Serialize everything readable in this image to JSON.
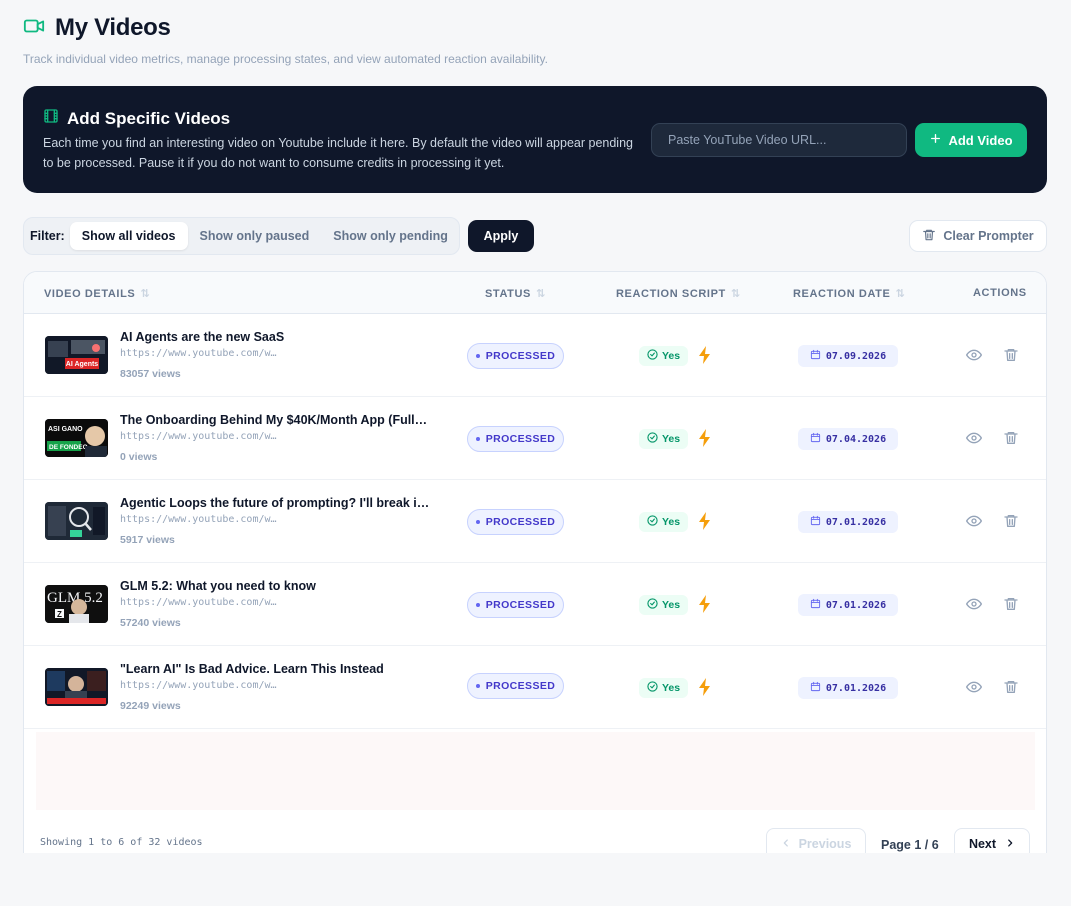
{
  "header": {
    "title": "My Videos",
    "subtitle": "Track individual video metrics, manage processing states, and view automated reaction availability."
  },
  "add_panel": {
    "title": "Add Specific Videos",
    "description": "Each time you find an interesting video on Youtube include it here. By default the video will appear pending to be processed. Pause it if you do not want to consume credits in processing it yet.",
    "url_placeholder": "Paste YouTube Video URL...",
    "add_label": "Add Video"
  },
  "filter": {
    "label": "Filter:",
    "tabs": [
      "Show all videos",
      "Show only paused",
      "Show only pending"
    ],
    "active": "Show all videos",
    "apply_label": "Apply",
    "clear_label": "Clear Prompter"
  },
  "table": {
    "columns": [
      "VIDEO DETAILS",
      "STATUS",
      "REACTION SCRIPT",
      "REACTION DATE",
      "ACTIONS"
    ],
    "rows": [
      {
        "title": "AI Agents are the new SaaS",
        "url": "https://www.youtube.com/w…",
        "views": "83057 views",
        "status": "PROCESSED",
        "script": "Yes",
        "date": "07.09.2026"
      },
      {
        "title": "The Onboarding Behind My $40K/Month App (Full …",
        "url": "https://www.youtube.com/w…",
        "views": "0 views",
        "status": "PROCESSED",
        "script": "Yes",
        "date": "07.04.2026"
      },
      {
        "title": "Agentic Loops the future of prompting? I'll break i…",
        "url": "https://www.youtube.com/w…",
        "views": "5917 views",
        "status": "PROCESSED",
        "script": "Yes",
        "date": "07.01.2026"
      },
      {
        "title": "GLM 5.2: What you need to know",
        "url": "https://www.youtube.com/w…",
        "views": "57240 views",
        "status": "PROCESSED",
        "script": "Yes",
        "date": "07.01.2026"
      },
      {
        "title": "\"Learn AI\" Is Bad Advice. Learn This Instead",
        "url": "https://www.youtube.com/w…",
        "views": "92249 views",
        "status": "PROCESSED",
        "script": "Yes",
        "date": "07.01.2026"
      }
    ]
  },
  "thumbnails": [
    {
      "icon": "thumbnail-ai-agents",
      "text": "AI Agents"
    },
    {
      "icon": "thumbnail-onboarding",
      "text": "ASI GANO · DE FONDEO"
    },
    {
      "icon": "thumbnail-agentic-loops",
      "text": ""
    },
    {
      "icon": "thumbnail-glm",
      "text": "GLM 5.2"
    },
    {
      "icon": "thumbnail-learn-ai",
      "text": ""
    }
  ],
  "pagination": {
    "summary": "Showing 1 to 6 of 32 videos",
    "prev_label": "Previous",
    "page_label": "Page 1 / 6",
    "next_label": "Next"
  },
  "colors": {
    "accent": "#10b981",
    "dark": "#0f172a",
    "status": "#4338ca",
    "bolt": "#f59e0b"
  }
}
